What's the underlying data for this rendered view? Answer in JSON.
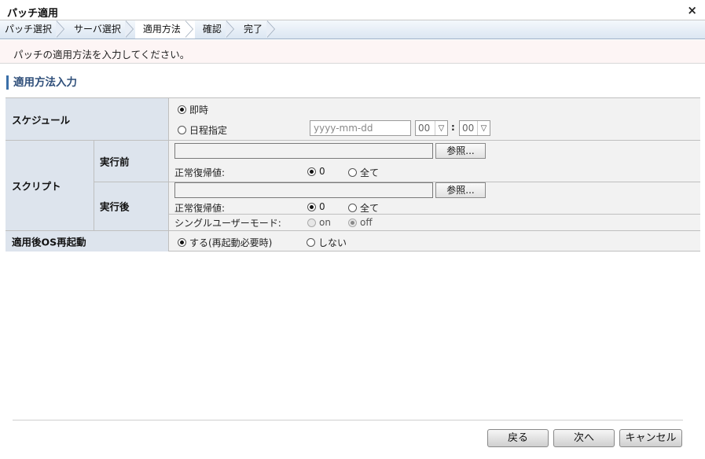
{
  "window": {
    "title": "パッチ適用",
    "close_glyph": "×"
  },
  "steps": [
    "パッチ選択",
    "サーバ選択",
    "適用方法",
    "確認",
    "完了"
  ],
  "active_step_index": 2,
  "message": "パッチの適用方法を入力してください。",
  "section_title": "適用方法入力",
  "form": {
    "schedule": {
      "label": "スケジュール",
      "immediate_label": "即時",
      "immediate_selected": true,
      "scheduled_label": "日程指定",
      "scheduled_selected": false,
      "date_placeholder": "yyyy-mm-dd",
      "hour_value": "00",
      "minute_value": "00",
      "time_separator": ":"
    },
    "script": {
      "label": "スクリプト",
      "pre": {
        "label": "実行前",
        "file_value": "",
        "browse_label": "参照...",
        "return_value_label": "正常復帰値:",
        "option_zero": "0",
        "option_all": "全て",
        "zero_selected": true
      },
      "post": {
        "label": "実行後",
        "file_value": "",
        "browse_label": "参照...",
        "return_value_label": "正常復帰値:",
        "option_zero": "0",
        "option_all": "全て",
        "zero_selected": true,
        "single_user_label": "シングルユーザーモード:",
        "on_label": "on",
        "off_label": "off",
        "off_selected": true
      }
    },
    "reboot": {
      "label": "適用後OS再起動",
      "yes_label": "する(再起動必要時)",
      "yes_selected": true,
      "no_label": "しない"
    }
  },
  "buttons": {
    "back": "戻る",
    "next": "次へ",
    "cancel": "キャンセル"
  }
}
